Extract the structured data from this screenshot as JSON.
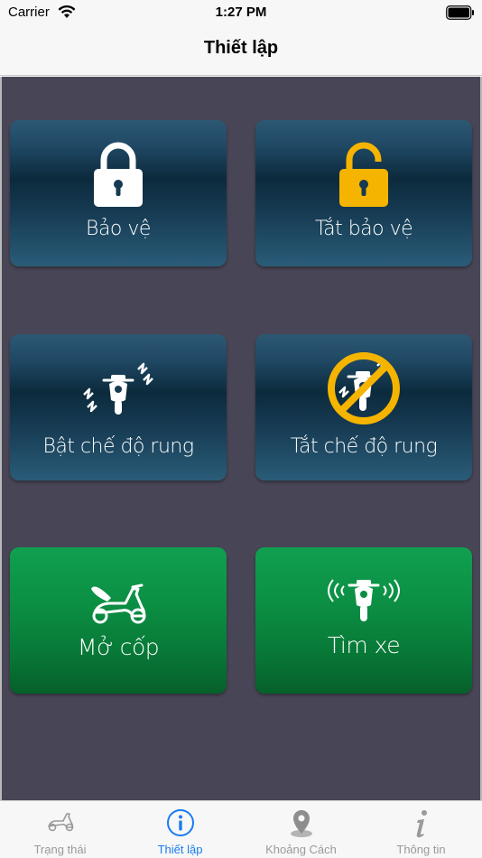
{
  "status_bar": {
    "carrier": "Carrier",
    "time": "1:27 PM"
  },
  "nav": {
    "title": "Thiết lập"
  },
  "tiles": [
    {
      "label": "Bảo vệ",
      "icon": "lock-closed-icon",
      "style": "blue"
    },
    {
      "label": "Tắt bảo vệ",
      "icon": "lock-open-icon",
      "style": "blue"
    },
    {
      "label": "Bật chế độ rung",
      "icon": "vibrate-on-scooter-icon",
      "style": "blue"
    },
    {
      "label": "Tắt chế độ rung",
      "icon": "vibrate-off-scooter-icon",
      "style": "blue"
    },
    {
      "label": "Mở cốp",
      "icon": "open-seat-scooter-icon",
      "style": "green"
    },
    {
      "label": "Tìm xe",
      "icon": "find-scooter-icon",
      "style": "green"
    }
  ],
  "tab_bar": {
    "items": [
      {
        "label": "Trạng thái",
        "icon": "scooter-icon",
        "active": false
      },
      {
        "label": "Thiết lập",
        "icon": "info-circle-icon",
        "active": true
      },
      {
        "label": "Khoảng Cách",
        "icon": "map-pin-icon",
        "active": false
      },
      {
        "label": "Thông tin",
        "icon": "info-italic-icon",
        "active": false
      }
    ]
  },
  "colors": {
    "tab_active": "#1a7cf0",
    "tab_inactive": "#9a9a9a",
    "background": "#484656",
    "lock_open_accent": "#f5b400"
  }
}
